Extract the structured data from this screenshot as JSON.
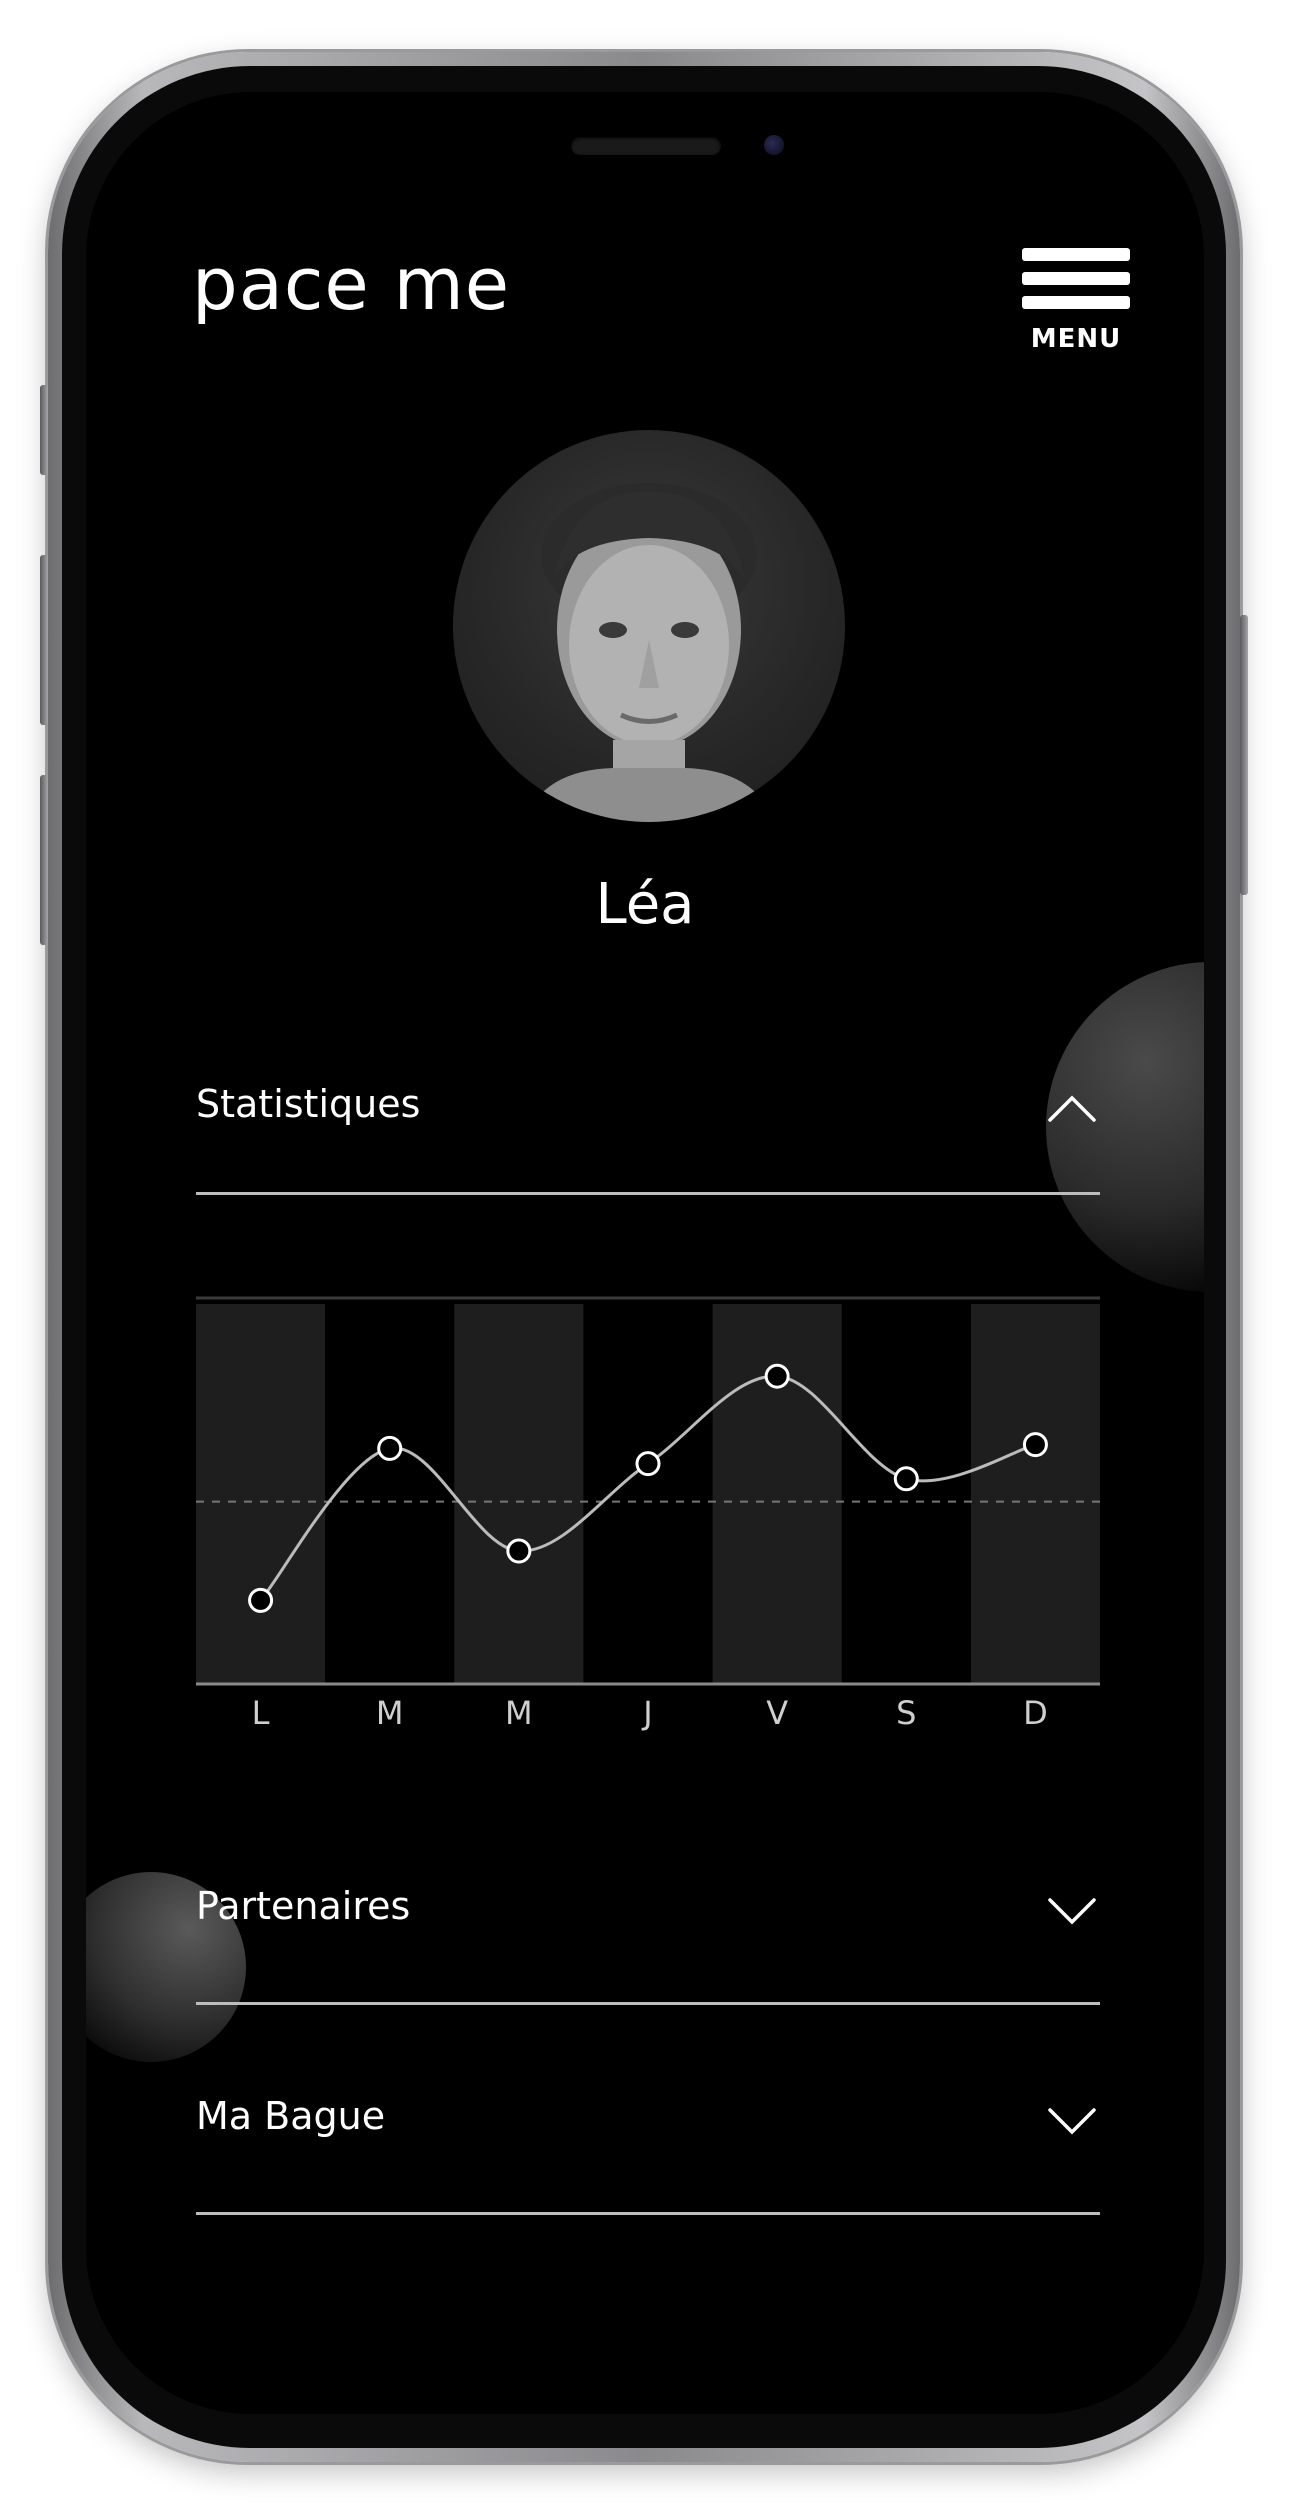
{
  "app": {
    "brand": "pace me",
    "menu_label": "MENU"
  },
  "profile": {
    "name": "Léa",
    "avatar_icon": "user-portrait"
  },
  "sections": [
    {
      "label": "Statistiques",
      "expanded": true
    },
    {
      "label": "Partenaires",
      "expanded": false
    },
    {
      "label": "Ma Bague",
      "expanded": false
    }
  ],
  "chart_data": {
    "type": "line",
    "categories": [
      "L",
      "M",
      "M",
      "J",
      "V",
      "S",
      "D"
    ],
    "values": [
      0.22,
      0.62,
      0.35,
      0.58,
      0.81,
      0.54,
      0.63
    ],
    "reference_line": 0.48,
    "ylim": [
      0,
      1
    ],
    "grid": false,
    "colors": {
      "line": "#bbbbbb",
      "band": "#1e1e1e",
      "reference": "#777777",
      "marker_fill": "#000000",
      "marker_stroke": "#ffffff"
    }
  },
  "colors": {
    "background": "#000000",
    "text": "#ffffff",
    "divider": "#bdbdbd"
  }
}
